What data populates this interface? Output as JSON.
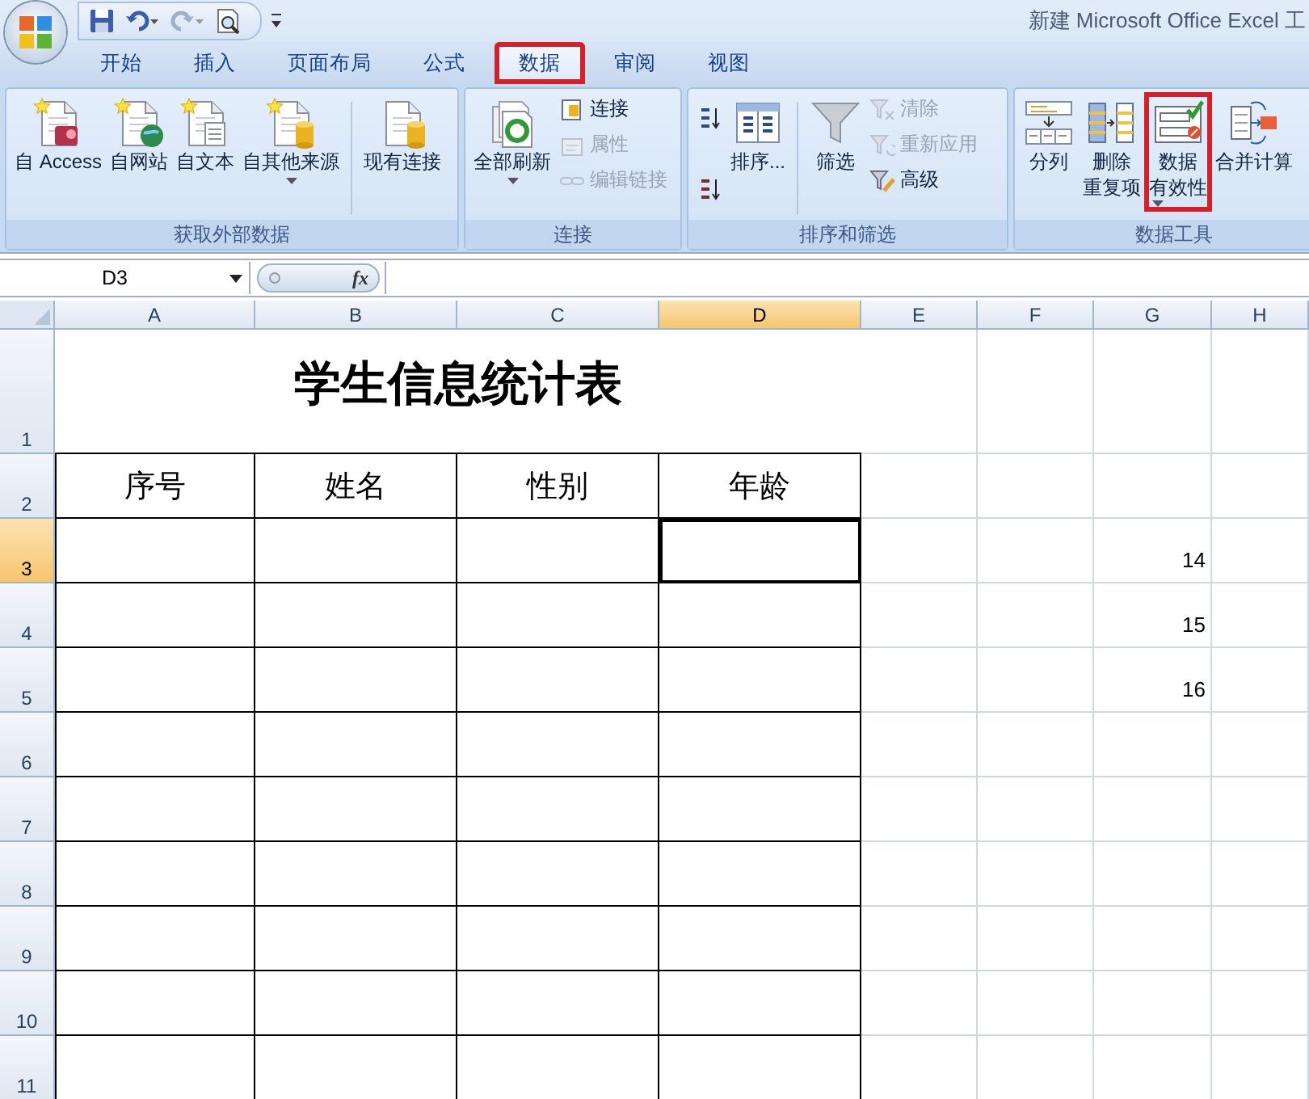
{
  "window": {
    "title": "新建 Microsoft Office Excel 工"
  },
  "tabs": [
    {
      "label": "开始",
      "selected": false,
      "highlighted": false
    },
    {
      "label": "插入",
      "selected": false,
      "highlighted": false
    },
    {
      "label": "页面布局",
      "selected": false,
      "highlighted": false
    },
    {
      "label": "公式",
      "selected": false,
      "highlighted": false
    },
    {
      "label": "数据",
      "selected": true,
      "highlighted": true
    },
    {
      "label": "审阅",
      "selected": false,
      "highlighted": false
    },
    {
      "label": "视图",
      "selected": false,
      "highlighted": false
    }
  ],
  "ribbon": {
    "groups": [
      {
        "label": "获取外部数据",
        "items": [
          {
            "kind": "large",
            "label": "自 Access",
            "dropdown": false,
            "highlighted": false
          },
          {
            "kind": "large",
            "label": "自网站",
            "dropdown": false,
            "highlighted": false
          },
          {
            "kind": "large",
            "label": "自文本",
            "dropdown": false,
            "highlighted": false
          },
          {
            "kind": "large",
            "label": "自其他来源",
            "dropdown": true,
            "highlighted": false
          },
          {
            "kind": "separator"
          },
          {
            "kind": "large",
            "label": "现有连接",
            "dropdown": false,
            "highlighted": false
          }
        ]
      },
      {
        "label": "连接",
        "items": [
          {
            "kind": "large",
            "label": "全部刷新",
            "dropdown": true,
            "highlighted": false
          },
          {
            "kind": "stack",
            "buttons": [
              {
                "label": "连接",
                "disabled": false
              },
              {
                "label": "属性",
                "disabled": true
              },
              {
                "label": "编辑链接",
                "disabled": true
              }
            ]
          }
        ]
      },
      {
        "label": "排序和筛选",
        "items": [
          {
            "kind": "stack",
            "buttons": [
              {
                "disabled": false
              },
              {
                "disabled": false
              }
            ]
          },
          {
            "kind": "large",
            "label": "排序...",
            "dropdown": false,
            "highlighted": false
          },
          {
            "kind": "separator"
          },
          {
            "kind": "large",
            "label": "筛选",
            "dropdown": false,
            "highlighted": false
          },
          {
            "kind": "stack",
            "buttons": [
              {
                "label": "清除",
                "disabled": true
              },
              {
                "label": "重新应用",
                "disabled": true
              },
              {
                "label": "高级",
                "disabled": false
              }
            ]
          }
        ]
      },
      {
        "label": "数据工具",
        "items": [
          {
            "kind": "large",
            "label": "分列",
            "dropdown": false,
            "highlighted": false
          },
          {
            "kind": "large",
            "label": [
              "删除",
              "重复项"
            ],
            "dropdown": false,
            "highlighted": false
          },
          {
            "kind": "large",
            "label": [
              "数据",
              "有效性"
            ],
            "dropdown": true,
            "highlighted": true
          },
          {
            "kind": "large",
            "label": "合并计算",
            "dropdown": false,
            "highlighted": false
          }
        ]
      }
    ]
  },
  "formula_bar": {
    "name_box": "D3",
    "function_label": "fx"
  },
  "sheet": {
    "columns": [
      {
        "label": "A",
        "selected": false
      },
      {
        "label": "B",
        "selected": false
      },
      {
        "label": "C",
        "selected": false
      },
      {
        "label": "D",
        "selected": true
      },
      {
        "label": "E",
        "selected": false
      },
      {
        "label": "F",
        "selected": false
      },
      {
        "label": "G",
        "selected": false
      },
      {
        "label": "H",
        "selected": false
      }
    ],
    "rows": [
      {
        "label": "1",
        "selected": false,
        "merged_title": "学生信息统计表"
      },
      {
        "label": "2",
        "selected": false,
        "cells": {
          "A": "序号",
          "B": "姓名",
          "C": "性别",
          "D": "年龄"
        }
      },
      {
        "label": "3",
        "selected": true,
        "cells": {
          "G": "14"
        }
      },
      {
        "label": "4",
        "selected": false,
        "cells": {
          "G": "15"
        }
      },
      {
        "label": "5",
        "selected": false,
        "cells": {
          "G": "16"
        }
      },
      {
        "label": "6",
        "selected": false
      },
      {
        "label": "7",
        "selected": false
      },
      {
        "label": "8",
        "selected": false
      },
      {
        "label": "9",
        "selected": false
      },
      {
        "label": "10",
        "selected": false
      },
      {
        "label": "11",
        "selected": false
      }
    ]
  }
}
